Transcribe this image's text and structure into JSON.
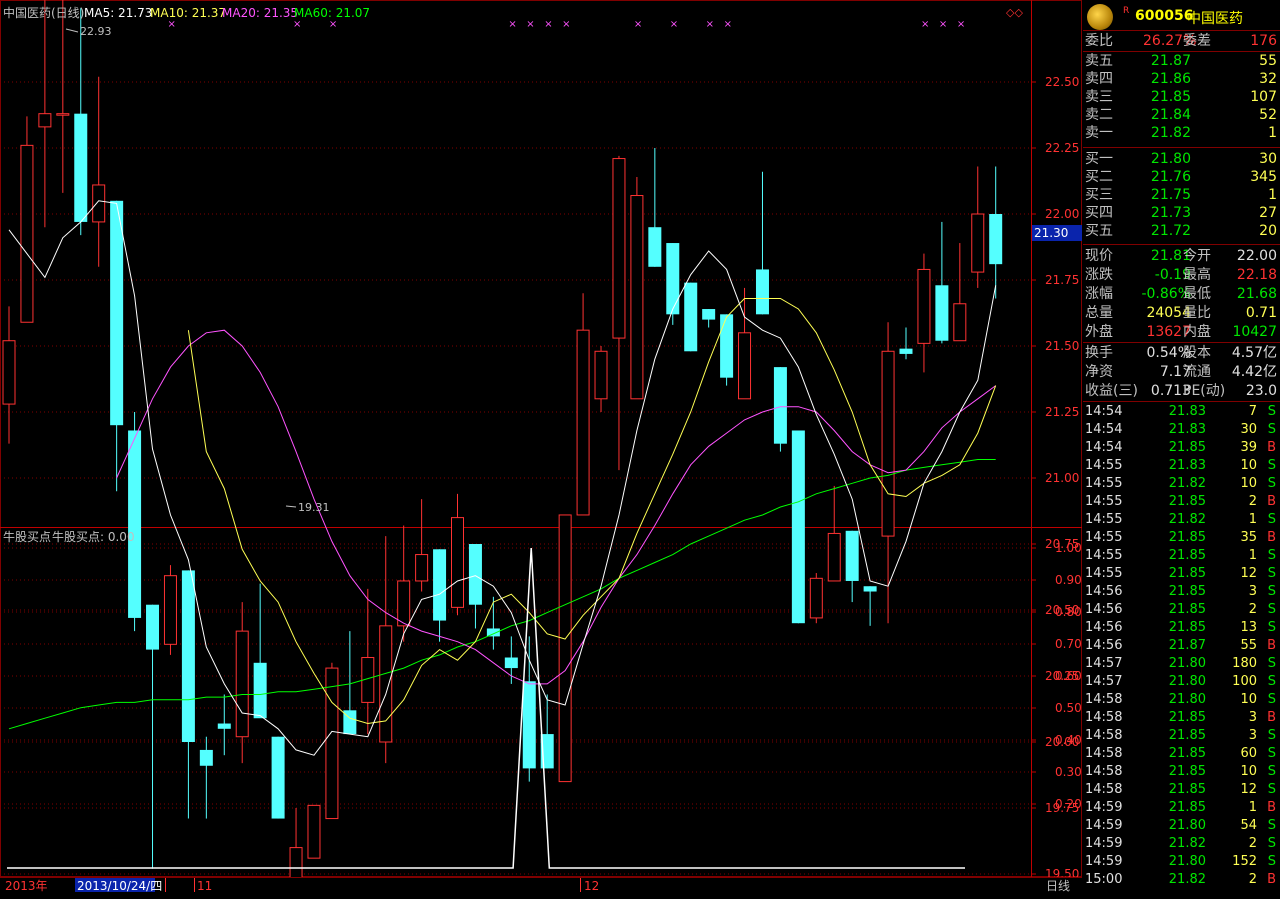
{
  "main_chart": {
    "title": "中国医药(日线)",
    "ma5_label": "MA5: 21.73",
    "ma10_label": "MA10: 21.37",
    "ma20_label": "MA20: 21.35",
    "ma60_label": "MA60: 21.07",
    "high_mark": "22.93",
    "low_mark": "19.31",
    "price_tag": "21.30",
    "colors": {
      "up": "#ff3232",
      "down": "#54ffff",
      "ma5": "#ffffff",
      "ma10": "#ffff54",
      "ma20": "#ff54ff",
      "ma60": "#00ff00"
    }
  },
  "indicator": {
    "title": "牛股买点",
    "value_label": "牛股买点: 0.00"
  },
  "bottom_bar": {
    "year": "2013年",
    "cursor_date": "2013/10/24/四",
    "month_11": "11",
    "month_12": "12",
    "period": "日线"
  },
  "chart_data": [
    {
      "type": "candlestick",
      "title": "中国医药(日线)",
      "ylim": [
        19.2,
        23.0
      ],
      "y_ticks": [
        "22.50",
        "22.25",
        "22.00",
        "21.75",
        "21.50",
        "21.25",
        "21.00",
        "20.75",
        "20.50",
        "20.25",
        "20.00",
        "19.75",
        "19.50"
      ],
      "candles": [
        {
          "o": 21.28,
          "h": 21.65,
          "l": 21.13,
          "c": 21.52
        },
        {
          "o": 21.59,
          "h": 22.37,
          "l": 21.59,
          "c": 22.26
        },
        {
          "o": 22.33,
          "h": 22.81,
          "l": 21.95,
          "c": 22.38
        },
        {
          "o": 22.38,
          "h": 22.93,
          "l": 22.08,
          "c": 22.38
        },
        {
          "o": 22.38,
          "h": 22.78,
          "l": 21.92,
          "c": 21.97
        },
        {
          "o": 21.97,
          "h": 22.52,
          "l": 21.8,
          "c": 22.11
        },
        {
          "o": 22.05,
          "h": 22.05,
          "l": 20.95,
          "c": 21.2
        },
        {
          "o": 21.18,
          "h": 21.25,
          "l": 20.42,
          "c": 20.47
        },
        {
          "o": 20.52,
          "h": 20.52,
          "l": 19.52,
          "c": 20.35
        },
        {
          "o": 20.37,
          "h": 20.67,
          "l": 20.33,
          "c": 20.63
        },
        {
          "o": 20.65,
          "h": 20.65,
          "l": 19.71,
          "c": 20.0
        },
        {
          "o": 19.97,
          "h": 20.02,
          "l": 19.71,
          "c": 19.91
        },
        {
          "o": 20.07,
          "h": 20.18,
          "l": 19.95,
          "c": 20.05
        },
        {
          "o": 20.02,
          "h": 20.53,
          "l": 19.92,
          "c": 20.42
        },
        {
          "o": 20.3,
          "h": 20.6,
          "l": 20.11,
          "c": 20.09
        },
        {
          "o": 20.02,
          "h": 20.02,
          "l": 19.71,
          "c": 19.71
        },
        {
          "o": 19.41,
          "h": 19.75,
          "l": 19.31,
          "c": 19.6
        },
        {
          "o": 19.56,
          "h": 19.76,
          "l": 19.56,
          "c": 19.76
        },
        {
          "o": 19.71,
          "h": 20.3,
          "l": 19.71,
          "c": 20.28
        },
        {
          "o": 20.12,
          "h": 20.42,
          "l": 20.05,
          "c": 20.03
        },
        {
          "o": 20.15,
          "h": 20.58,
          "l": 20.03,
          "c": 20.32
        },
        {
          "o": 20.0,
          "h": 20.78,
          "l": 19.92,
          "c": 20.44
        },
        {
          "o": 20.44,
          "h": 20.82,
          "l": 20.38,
          "c": 20.61
        },
        {
          "o": 20.61,
          "h": 20.92,
          "l": 20.57,
          "c": 20.71
        },
        {
          "o": 20.73,
          "h": 20.73,
          "l": 20.38,
          "c": 20.46
        },
        {
          "o": 20.51,
          "h": 20.94,
          "l": 20.48,
          "c": 20.85
        },
        {
          "o": 20.75,
          "h": 20.75,
          "l": 20.43,
          "c": 20.52
        },
        {
          "o": 20.43,
          "h": 20.55,
          "l": 20.35,
          "c": 20.4
        },
        {
          "o": 20.32,
          "h": 20.4,
          "l": 20.22,
          "c": 20.28
        },
        {
          "o": 20.23,
          "h": 20.4,
          "l": 19.85,
          "c": 19.9
        },
        {
          "o": 20.03,
          "h": 20.18,
          "l": 19.9,
          "c": 19.9
        },
        {
          "o": 19.85,
          "h": 20.86,
          "l": 19.85,
          "c": 20.86
        },
        {
          "o": 20.86,
          "h": 21.7,
          "l": 20.86,
          "c": 21.56
        },
        {
          "o": 21.3,
          "h": 21.5,
          "l": 21.25,
          "c": 21.48
        },
        {
          "o": 21.53,
          "h": 22.22,
          "l": 21.03,
          "c": 22.21
        },
        {
          "o": 21.3,
          "h": 22.14,
          "l": 21.3,
          "c": 22.07
        },
        {
          "o": 21.95,
          "h": 22.25,
          "l": 21.8,
          "c": 21.8
        },
        {
          "o": 21.89,
          "h": 21.89,
          "l": 21.58,
          "c": 21.62
        },
        {
          "o": 21.74,
          "h": 21.74,
          "l": 21.48,
          "c": 21.48
        },
        {
          "o": 21.64,
          "h": 21.64,
          "l": 21.57,
          "c": 21.6
        },
        {
          "o": 21.62,
          "h": 21.62,
          "l": 21.35,
          "c": 21.38
        },
        {
          "o": 21.3,
          "h": 21.72,
          "l": 21.3,
          "c": 21.55
        },
        {
          "o": 21.79,
          "h": 22.16,
          "l": 21.62,
          "c": 21.62
        },
        {
          "o": 21.42,
          "h": 21.42,
          "l": 21.1,
          "c": 21.13
        },
        {
          "o": 21.18,
          "h": 21.18,
          "l": 20.45,
          "c": 20.45
        },
        {
          "o": 20.47,
          "h": 20.64,
          "l": 20.45,
          "c": 20.62
        },
        {
          "o": 20.61,
          "h": 20.97,
          "l": 20.61,
          "c": 20.79
        },
        {
          "o": 20.8,
          "h": 20.8,
          "l": 20.53,
          "c": 20.61
        },
        {
          "o": 20.59,
          "h": 20.59,
          "l": 20.44,
          "c": 20.57
        },
        {
          "o": 20.78,
          "h": 21.59,
          "l": 20.45,
          "c": 21.48
        },
        {
          "o": 21.49,
          "h": 21.57,
          "l": 21.45,
          "c": 21.47
        },
        {
          "o": 21.51,
          "h": 21.85,
          "l": 21.4,
          "c": 21.79
        },
        {
          "o": 21.73,
          "h": 21.97,
          "l": 21.51,
          "c": 21.52
        },
        {
          "o": 21.52,
          "h": 21.89,
          "l": 21.52,
          "c": 21.66
        },
        {
          "o": 21.78,
          "h": 22.18,
          "l": 21.72,
          "c": 22.0
        },
        {
          "o": 22.0,
          "h": 22.18,
          "l": 21.68,
          "c": 21.81
        }
      ],
      "ma5": [
        21.94,
        21.85,
        21.76,
        21.91,
        21.97,
        22.05,
        22.04,
        21.69,
        21.11,
        20.86,
        20.69,
        20.36,
        20.22,
        20.11,
        20.1,
        20.05,
        19.97,
        19.95,
        20.04,
        20.03,
        20.02,
        20.18,
        20.41,
        20.54,
        20.56,
        20.61,
        20.63,
        20.59,
        20.49,
        20.31,
        20.16,
        20.14,
        20.37,
        20.59,
        20.86,
        21.18,
        21.45,
        21.64,
        21.77,
        21.86,
        21.79,
        21.61,
        21.56,
        21.53,
        21.42,
        21.24,
        21.09,
        20.92,
        20.61,
        20.59,
        20.76,
        20.98,
        21.1,
        21.25,
        21.37,
        21.73
      ],
      "ma10": [
        null,
        null,
        null,
        null,
        null,
        null,
        null,
        null,
        null,
        null,
        21.56,
        21.1,
        20.96,
        20.73,
        20.61,
        20.53,
        20.38,
        20.26,
        20.15,
        20.09,
        20.07,
        20.08,
        20.16,
        20.29,
        20.35,
        20.31,
        20.38,
        20.53,
        20.56,
        20.49,
        20.41,
        20.39,
        20.48,
        20.55,
        20.62,
        20.79,
        20.94,
        21.09,
        21.25,
        21.44,
        21.61,
        21.68,
        21.68,
        21.68,
        21.64,
        21.55,
        21.41,
        21.25,
        21.05,
        20.94,
        20.93,
        20.98,
        21.01,
        21.05,
        21.17,
        21.35
      ],
      "ma20": [
        null,
        null,
        null,
        null,
        null,
        null,
        21.0,
        21.15,
        21.3,
        21.42,
        21.5,
        21.55,
        21.56,
        21.5,
        21.4,
        21.27,
        21.1,
        20.92,
        20.76,
        20.63,
        20.54,
        20.49,
        20.45,
        20.42,
        20.4,
        20.38,
        20.35,
        20.3,
        20.25,
        20.22,
        20.22,
        20.27,
        20.38,
        20.51,
        20.62,
        20.71,
        20.82,
        20.94,
        21.05,
        21.12,
        21.17,
        21.22,
        21.25,
        21.27,
        21.27,
        21.25,
        21.18,
        21.1,
        21.05,
        21.02,
        21.03,
        21.1,
        21.19,
        21.25,
        21.3,
        21.35
      ],
      "ma60": [
        20.05,
        20.07,
        20.09,
        20.11,
        20.13,
        20.14,
        20.15,
        20.15,
        20.16,
        20.16,
        20.16,
        20.17,
        20.17,
        20.18,
        20.18,
        20.19,
        20.19,
        20.2,
        20.21,
        20.22,
        20.24,
        20.26,
        20.28,
        20.31,
        20.33,
        20.36,
        20.38,
        20.41,
        20.44,
        20.46,
        20.49,
        20.52,
        20.55,
        20.58,
        20.62,
        20.65,
        20.68,
        20.71,
        20.75,
        20.78,
        20.81,
        20.84,
        20.86,
        20.89,
        20.91,
        20.94,
        20.96,
        20.98,
        21.0,
        21.01,
        21.03,
        21.04,
        21.05,
        21.06,
        21.07,
        21.07
      ]
    },
    {
      "type": "line",
      "title": "牛股买点",
      "ylim": [
        0.0,
        1.05
      ],
      "y_ticks": [
        "1.00",
        "0.90",
        "0.80",
        "0.70",
        "0.60",
        "0.50",
        "0.40",
        "0.30",
        "0.20"
      ],
      "values": [
        0,
        0,
        0,
        0,
        0,
        0,
        0,
        0,
        0,
        0,
        0,
        0,
        0,
        0,
        0,
        0,
        0,
        0,
        0,
        0,
        0,
        0,
        0,
        0,
        0,
        0,
        0,
        0,
        0,
        1,
        0,
        0,
        0,
        0,
        0,
        0,
        0,
        0,
        0,
        0,
        0,
        0,
        0,
        0,
        0,
        0,
        0,
        0,
        0,
        0,
        0,
        0,
        0,
        0
      ]
    }
  ],
  "quote_panel": {
    "code": "600056",
    "name": "中国医药",
    "wb_label": "委比",
    "wb_value": "26.27%",
    "wc_label": "委差",
    "wc_value": "176",
    "asks": [
      {
        "label": "卖五",
        "price": "21.87",
        "vol": "55"
      },
      {
        "label": "卖四",
        "price": "21.86",
        "vol": "32"
      },
      {
        "label": "卖三",
        "price": "21.85",
        "vol": "107"
      },
      {
        "label": "卖二",
        "price": "21.84",
        "vol": "52"
      },
      {
        "label": "卖一",
        "price": "21.82",
        "vol": "1"
      }
    ],
    "bids": [
      {
        "label": "买一",
        "price": "21.80",
        "vol": "30"
      },
      {
        "label": "买二",
        "price": "21.76",
        "vol": "345"
      },
      {
        "label": "买三",
        "price": "21.75",
        "vol": "1"
      },
      {
        "label": "买四",
        "price": "21.73",
        "vol": "27"
      },
      {
        "label": "买五",
        "price": "21.72",
        "vol": "20"
      }
    ],
    "stats": [
      {
        "l1": "现价",
        "v1": "21.81",
        "c1": "grn",
        "l2": "今开",
        "v2": "22.00",
        "c2": "wht"
      },
      {
        "l1": "涨跌",
        "v1": "-0.19",
        "c1": "grn",
        "l2": "最高",
        "v2": "22.18",
        "c2": "red"
      },
      {
        "l1": "涨幅",
        "v1": "-0.86%",
        "c1": "grn",
        "l2": "最低",
        "v2": "21.68",
        "c2": "grn"
      },
      {
        "l1": "总量",
        "v1": "24054",
        "c1": "yel",
        "l2": "量比",
        "v2": "0.71",
        "c2": "yel"
      },
      {
        "l1": "外盘",
        "v1": "13627",
        "c1": "red",
        "l2": "内盘",
        "v2": "10427",
        "c2": "grn"
      }
    ],
    "stats2": [
      {
        "l1": "换手",
        "v1": "0.54%",
        "l2": "股本",
        "v2": "4.57亿"
      },
      {
        "l1": "净资",
        "v1": "7.17",
        "l2": "流通",
        "v2": "4.42亿"
      },
      {
        "l1": "收益(三)",
        "v1": "0.713",
        "l2": "PE(动)",
        "v2": "23.0"
      }
    ],
    "trades": [
      {
        "t": "14:54",
        "p": "21.83",
        "v": "7",
        "d": "S"
      },
      {
        "t": "14:54",
        "p": "21.83",
        "v": "30",
        "d": "S"
      },
      {
        "t": "14:54",
        "p": "21.85",
        "v": "39",
        "d": "B"
      },
      {
        "t": "14:55",
        "p": "21.83",
        "v": "10",
        "d": "S"
      },
      {
        "t": "14:55",
        "p": "21.82",
        "v": "10",
        "d": "S"
      },
      {
        "t": "14:55",
        "p": "21.85",
        "v": "2",
        "d": "B"
      },
      {
        "t": "14:55",
        "p": "21.82",
        "v": "1",
        "d": "S"
      },
      {
        "t": "14:55",
        "p": "21.85",
        "v": "35",
        "d": "B"
      },
      {
        "t": "14:55",
        "p": "21.85",
        "v": "1",
        "d": "S"
      },
      {
        "t": "14:55",
        "p": "21.85",
        "v": "12",
        "d": "S"
      },
      {
        "t": "14:56",
        "p": "21.85",
        "v": "3",
        "d": "S"
      },
      {
        "t": "14:56",
        "p": "21.85",
        "v": "2",
        "d": "S"
      },
      {
        "t": "14:56",
        "p": "21.85",
        "v": "13",
        "d": "S"
      },
      {
        "t": "14:56",
        "p": "21.87",
        "v": "55",
        "d": "B"
      },
      {
        "t": "14:57",
        "p": "21.80",
        "v": "180",
        "d": "S"
      },
      {
        "t": "14:57",
        "p": "21.80",
        "v": "100",
        "d": "S"
      },
      {
        "t": "14:58",
        "p": "21.80",
        "v": "10",
        "d": "S"
      },
      {
        "t": "14:58",
        "p": "21.85",
        "v": "3",
        "d": "B"
      },
      {
        "t": "14:58",
        "p": "21.85",
        "v": "3",
        "d": "S"
      },
      {
        "t": "14:58",
        "p": "21.85",
        "v": "60",
        "d": "S"
      },
      {
        "t": "14:58",
        "p": "21.85",
        "v": "10",
        "d": "S"
      },
      {
        "t": "14:58",
        "p": "21.85",
        "v": "12",
        "d": "S"
      },
      {
        "t": "14:59",
        "p": "21.85",
        "v": "1",
        "d": "B"
      },
      {
        "t": "14:59",
        "p": "21.80",
        "v": "54",
        "d": "S"
      },
      {
        "t": "14:59",
        "p": "21.82",
        "v": "2",
        "d": "S"
      },
      {
        "t": "14:59",
        "p": "21.80",
        "v": "152",
        "d": "S"
      },
      {
        "t": "15:00",
        "p": "21.82",
        "v": "2",
        "d": "B"
      }
    ]
  }
}
